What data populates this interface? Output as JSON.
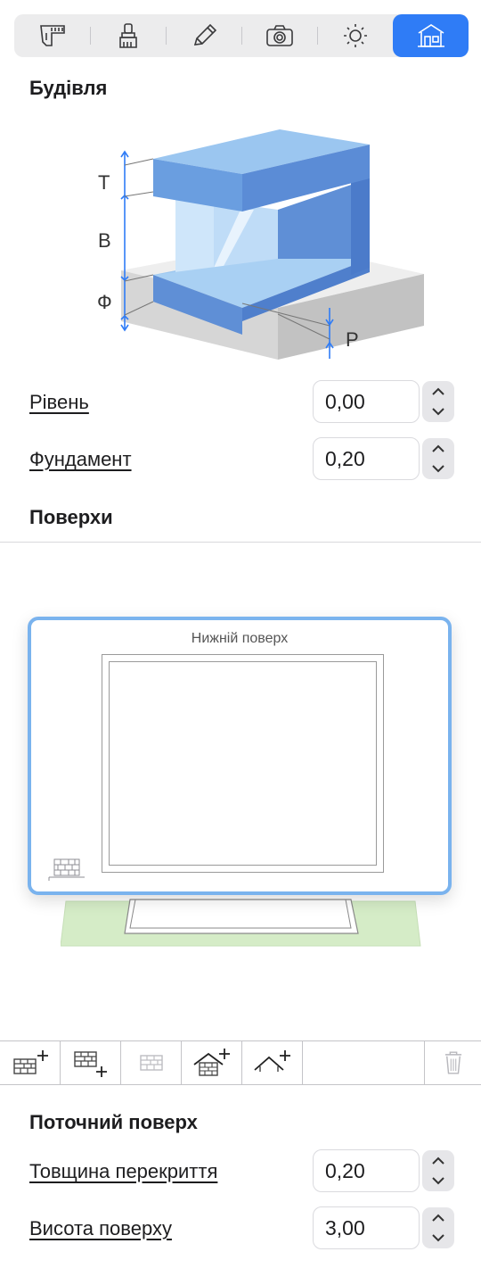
{
  "tabs": [
    {
      "icon": "measure-icon",
      "active": false
    },
    {
      "icon": "brush-icon",
      "active": false
    },
    {
      "icon": "pencil-icon",
      "active": false
    },
    {
      "icon": "camera-icon",
      "active": false
    },
    {
      "icon": "sun-icon",
      "active": false
    },
    {
      "icon": "building-icon",
      "active": true
    }
  ],
  "building": {
    "title": "Будівля",
    "diagram": {
      "label_t": "Т",
      "label_b": "В",
      "label_f": "Ф",
      "label_r": "Р"
    },
    "level_label": "Рівень",
    "level_value": "0,00",
    "foundation_label": "Фундамент",
    "foundation_value": "0,20"
  },
  "floors": {
    "title": "Поверхи",
    "floor_name": "Нижній поверх"
  },
  "toolbar": {
    "buttons": [
      "add-floor-above-icon",
      "add-floor-below-icon",
      "floor-icon",
      "add-roof-icon",
      "add-roof-outline-icon",
      "trash-icon"
    ]
  },
  "current_floor": {
    "title": "Поточний поверх",
    "slab_label": "Товщина перекриття",
    "slab_value": "0,20",
    "height_label": "Висота поверху",
    "height_value": "3,00"
  },
  "colors": {
    "accent": "#2f7cf6",
    "selection": "#7ab3ee",
    "building_blue": "#6a9ee0",
    "ground": "#d8d8d8",
    "floor_green": "#d5ecc7"
  }
}
